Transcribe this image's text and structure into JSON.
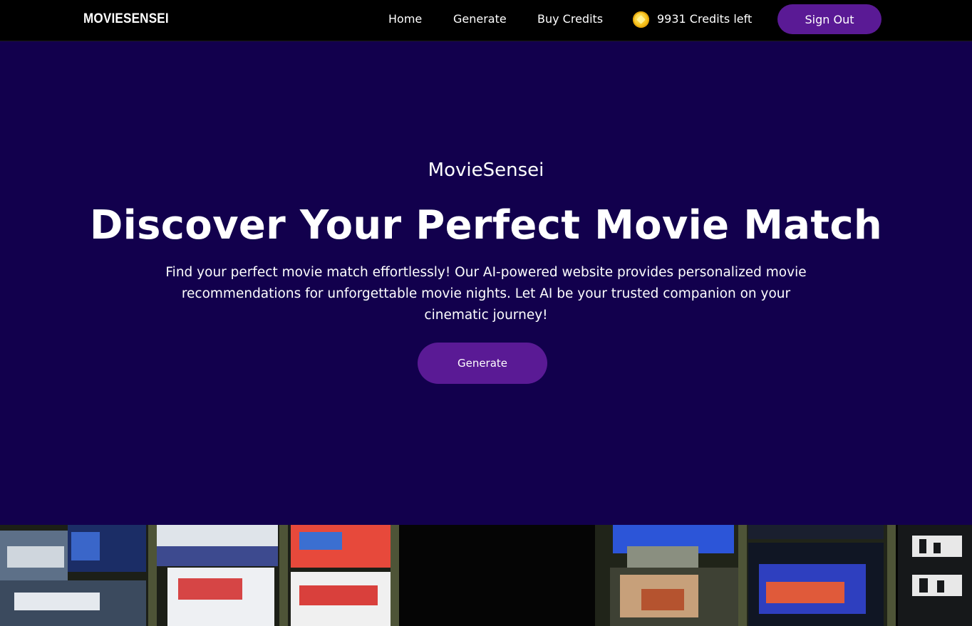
{
  "navbar": {
    "brand": "MOVIESENSEI",
    "links": [
      {
        "label": "Home"
      },
      {
        "label": "Generate"
      },
      {
        "label": "Buy Credits"
      }
    ],
    "credits_text": "9931 Credits left",
    "coin_icon": "coin-icon",
    "signout_label": "Sign Out"
  },
  "hero": {
    "kicker": "MovieSensei",
    "title": "Discover Your Perfect Movie Match",
    "description": "Find your perfect movie match effortlessly! Our AI-powered website provides personalized movie recommendations for unforgettable movie nights. Let AI be your trusted companion on your cinematic journey!",
    "button_label": "Generate"
  },
  "colors": {
    "navbar_bg": "#000000",
    "hero_bg": "#12004d",
    "accent": "#5a1a95",
    "coin": "#f7c21b"
  }
}
